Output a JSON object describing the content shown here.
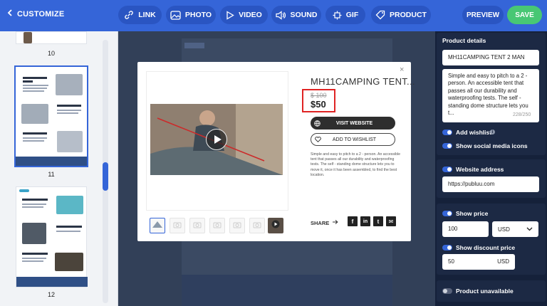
{
  "topbar": {
    "back_label": "CUSTOMIZE",
    "tools": [
      {
        "label": "LINK",
        "icon": "link-icon"
      },
      {
        "label": "PHOTO",
        "icon": "photo-icon"
      },
      {
        "label": "VIDEO",
        "icon": "video-icon"
      },
      {
        "label": "SOUND",
        "icon": "sound-icon"
      },
      {
        "label": "GIF",
        "icon": "gif-icon"
      },
      {
        "label": "PRODUCT",
        "icon": "tag-icon"
      }
    ],
    "preview_label": "PREVIEW",
    "save_label": "SAVE"
  },
  "sidebar": {
    "pages": [
      {
        "number": "10"
      },
      {
        "number": "11"
      },
      {
        "number": "12"
      }
    ],
    "thumb11": {
      "heading1": "DEVEX CAMPING TENT 3 MAN",
      "heading2": "CAMPING TENT BENCH 2-SET STRETCH",
      "heading3": "CAMPING TENT FOR 4 PEOPLE - WHITE"
    },
    "thumb12": {
      "heading1": "CAMPING PRO POLE, PATHED 4 + 4 PEOPLE - TURQUOISE",
      "heading2": "CAMPING SLEEPING BAG",
      "heading3": "AIR BAGS INFLATABLE CAMPING PILLOW"
    }
  },
  "modal": {
    "close_glyph": "×",
    "title": "MH11CAMPING TENT...",
    "old_price": "$ 100",
    "new_price": "$50",
    "visit_label": "VISIT WEBSITE",
    "wishlist_label": "ADD TO WISHLIST",
    "description": "Simple and easy to pitch to a 2 - person. An accessible tent that passes all our durability and waterproofing tests. The self - standing dome structure lets you to move it, once it has been assembled, to find the best location.",
    "share_label": "SHARE",
    "social": [
      "f",
      "in",
      "t",
      "✉"
    ]
  },
  "panel": {
    "product_details_title": "Product details",
    "product_name": "MH11CAMPING TENT 2 MAN",
    "product_desc": "Simple and easy to pitch to a 2 - person. An accessible tent that passes all our durability and waterproofing tests. The self - standing dome structure lets you t...",
    "char_count": "228/250",
    "add_wishlist_label": "Add wishlist",
    "show_social_label": "Show social media icons",
    "website_label": "Website address",
    "website_value": "https://publuu.com",
    "show_price_label": "Show price",
    "price_value": "100",
    "currency": "USD",
    "show_discount_label": "Show discount price",
    "discount_value": "50",
    "discount_currency": "USD",
    "unavailable_label": "Product unavailable"
  },
  "colors": {
    "topbar": "#3565d8",
    "save": "#48c774",
    "highlight": "#e02424",
    "panel": "#15213a"
  }
}
